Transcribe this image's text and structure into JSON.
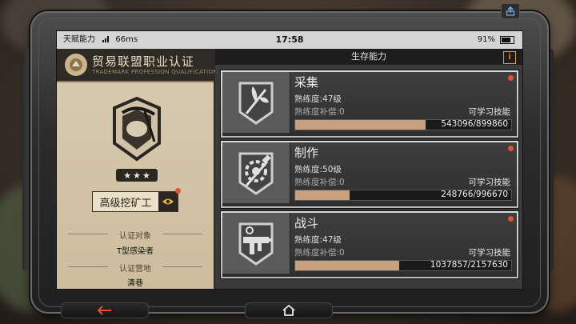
{
  "status_bar": {
    "carrier": "天赋能力",
    "ping": "66ms",
    "time": "17:58",
    "battery": "91%"
  },
  "certificate": {
    "title": "贸易联盟职业认证",
    "subtitle": "TRADEMARK PROFESSION QUALIFICATION",
    "rank_label": "高级挖矿工",
    "stars": 3,
    "target_label": "认证对象",
    "target_value": "T型感染者",
    "location_label": "认证营地",
    "location_value": "清巷"
  },
  "panel": {
    "title": "生存能力",
    "info_icon": "info-icon"
  },
  "skills": [
    {
      "name": "采集",
      "proficiency": "熟练度:47级",
      "compensation": "熟练度补偿:0",
      "learnable": "可学习技能",
      "xp": "543096/899860",
      "progress": 0.6035,
      "icon": "herb-gathering-icon"
    },
    {
      "name": "制作",
      "proficiency": "熟练度:50级",
      "compensation": "熟练度补偿:0",
      "learnable": "可学习技能",
      "xp": "248766/996670",
      "progress": 0.2496,
      "icon": "crafting-gear-icon"
    },
    {
      "name": "战斗",
      "proficiency": "熟练度:47级",
      "compensation": "熟练度补偿:0",
      "learnable": "可学习技能",
      "xp": "1037857/2157630",
      "progress": 0.481,
      "icon": "submachine-gun-icon"
    }
  ],
  "colors": {
    "accent": "#c9a07e",
    "notify": "#e8502f",
    "highlight": "#e07b2b"
  }
}
